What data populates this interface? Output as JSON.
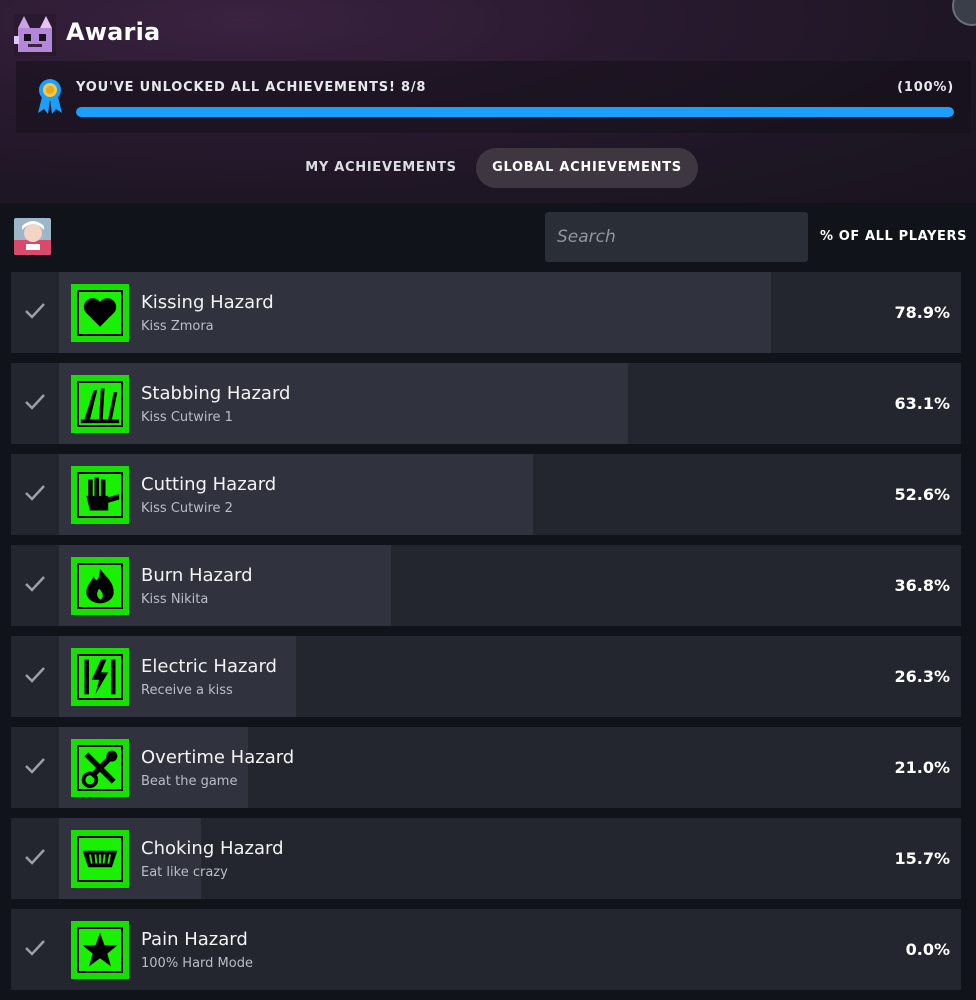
{
  "app": {
    "title": "Awaria"
  },
  "unlock": {
    "message": "YOU'VE UNLOCKED ALL ACHIEVEMENTS! 8/8",
    "percent_label": "(100%)",
    "progress_fraction": 1.0,
    "accent_color": "#1a9fff"
  },
  "tabs": [
    {
      "label": "MY ACHIEVEMENTS",
      "active": false
    },
    {
      "label": "GLOBAL ACHIEVEMENTS",
      "active": true
    }
  ],
  "search": {
    "placeholder": "Search"
  },
  "column_header": "% OF ALL PLAYERS",
  "achievements": [
    {
      "title": "Kissing Hazard",
      "desc": "Kiss Zmora",
      "pct_label": "78.9%",
      "pct": 78.9,
      "icon": "heart-icon"
    },
    {
      "title": "Stabbing Hazard",
      "desc": "Kiss Cutwire 1",
      "pct_label": "63.1%",
      "pct": 63.1,
      "icon": "knife-icon"
    },
    {
      "title": "Cutting Hazard",
      "desc": "Kiss Cutwire 2",
      "pct_label": "52.6%",
      "pct": 52.6,
      "icon": "hand-cut-icon"
    },
    {
      "title": "Burn Hazard",
      "desc": "Kiss Nikita",
      "pct_label": "36.8%",
      "pct": 36.8,
      "icon": "flame-icon"
    },
    {
      "title": "Electric Hazard",
      "desc": "Receive a kiss",
      "pct_label": "26.3%",
      "pct": 26.3,
      "icon": "lightning-icon"
    },
    {
      "title": "Overtime Hazard",
      "desc": "Beat the game",
      "pct_label": "21.0%",
      "pct": 21.0,
      "icon": "tools-icon"
    },
    {
      "title": "Choking Hazard",
      "desc": "Eat like crazy",
      "pct_label": "15.7%",
      "pct": 15.7,
      "icon": "mouth-icon"
    },
    {
      "title": "Pain Hazard",
      "desc": "100% Hard Mode",
      "pct_label": "0.0%",
      "pct": 0.0,
      "icon": "star-icon"
    }
  ],
  "colors": {
    "hazard_green": "#18f200",
    "row_bg": "#23262e",
    "row_fill": "#30333d"
  }
}
